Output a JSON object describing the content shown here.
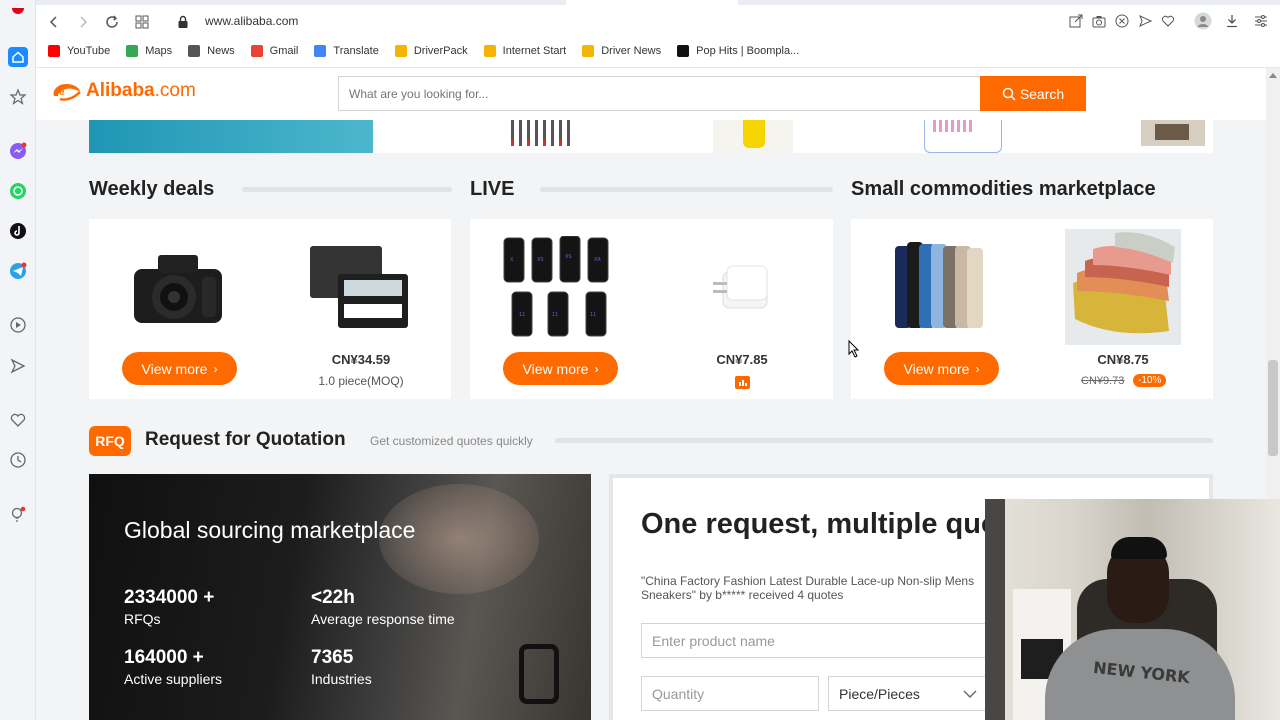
{
  "browser": {
    "url": "www.alibaba.com",
    "bookmarks": [
      {
        "label": "YouTube",
        "color": "#ff0000"
      },
      {
        "label": "Maps",
        "color": "#34a853"
      },
      {
        "label": "News",
        "color": "#555555"
      },
      {
        "label": "Gmail",
        "color": "#ea4335"
      },
      {
        "label": "Translate",
        "color": "#4285f4"
      },
      {
        "label": "DriverPack",
        "color": "#f4b400"
      },
      {
        "label": "Internet Start",
        "color": "#f4b400"
      },
      {
        "label": "Driver News",
        "color": "#f4b400"
      },
      {
        "label": "Pop Hits | Boompla...",
        "color": "#111111"
      }
    ]
  },
  "header": {
    "logo_main": "Alibaba",
    "logo_suffix": ".com",
    "search_placeholder": "What are you looking for...",
    "search_label": "Search",
    "accent": "#ff6a00"
  },
  "sections": {
    "weekly": {
      "title": "Weekly deals",
      "view_more": "View more",
      "price": "CN¥34.59",
      "sub": "1.0 piece(MOQ)"
    },
    "live": {
      "title": "LIVE",
      "view_more": "View more",
      "price": "CN¥7.85"
    },
    "small": {
      "title": "Small commodities marketplace",
      "view_more": "View more",
      "price": "CN¥8.75",
      "old_price": "CN¥9.73",
      "discount": "-10%"
    }
  },
  "rfq": {
    "logo": "RFQ",
    "title": "Request for Quotation",
    "subtitle": "Get customized quotes quickly",
    "sourcing": {
      "title": "Global sourcing marketplace",
      "stats": [
        {
          "value": "2334000 +",
          "label": "RFQs"
        },
        {
          "value": "<22h",
          "label": "Average response time"
        },
        {
          "value": "164000 +",
          "label": "Active suppliers"
        },
        {
          "value": "7365",
          "label": "Industries"
        }
      ]
    },
    "form": {
      "title": "One request, multiple quotes",
      "note": "\"China Factory Fashion Latest Durable Lace-up Non-slip Mens Sneakers\" by b*****  received 4 quotes",
      "product_placeholder": "Enter product name",
      "quantity_placeholder": "Quantity",
      "unit": "Piece/Pieces"
    }
  },
  "webcam": {
    "shirt_text": "NEW YORK"
  }
}
